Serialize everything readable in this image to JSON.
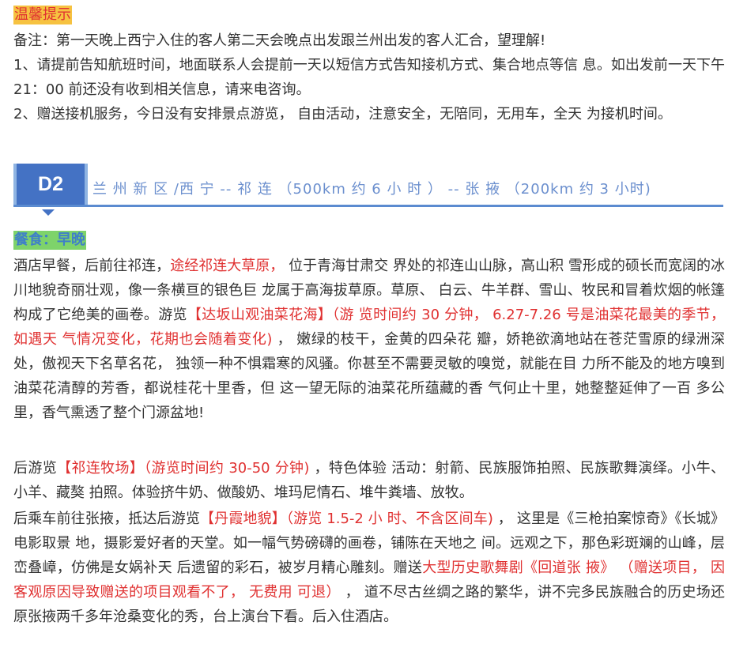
{
  "tips": {
    "title": "温馨提示",
    "note": "备注：第一天晚上西宁入住的客人第二天会晚点出发跟兰州出发的客人汇合，望理解!",
    "item1": "1、请提前告知航班时间，地面联系人会提前一天以短信方式告知接机方式、集合地点等信 息。如出发前一天下午 21：00 前还没有收到相关信息，请来电咨询。",
    "item2": "2、赠送接机服务，今日没有安排景点游览， 自由活动，注意安全，无陪同，无用车，全天 为接机时间。"
  },
  "day": {
    "label": "D2",
    "route": "兰 州 新 区 /西 宁 -- 祁 连 （500km 约 6 小 时 ） -- 张 掖 （200km 约 3 小时)"
  },
  "meals": "餐食：早晚",
  "p1": {
    "t1": "酒店早餐，后前往祁连，",
    "r1": "途经祁连大草原，",
    "t2": " 位于青海甘肃交 界处的祁连山山脉，高山积 雪形成的硕长而宽阔的冰川地貌奇丽壮观，像一条横亘的银色巨 龙属于高海拔草原。草原、 白云、牛羊群、雪山、牧民和冒着炊烟的帐篷构成了它绝美的画卷。游览",
    "r2": "【达坂山观油菜花海】（游 览时间约 30 分钟， 6.27-7.26 号是油菜花最美的季节， 如遇天 气情况变化，花期也会随着变化)",
    "t3": " ， 嫩绿的枝干，金黄的四朵花 瓣，娇艳欲滴地站在苍茫雪原的绿洲深处，傲视天下名草名花， 独领一种不惧霜寒的风骚。你甚至不需要灵敏的嗅觉，就能在目 力所不能及的地方嗅到油菜花清醇的芳香，都说桂花十里香，但 这一望无际的油菜花所蕴藏的香 气何止十里，她整整延伸了一百 多公里，香气熏透了整个门源盆地!"
  },
  "p2": {
    "t1": "后游览",
    "r1": "【祁连牧场】（游览时间约 30-50 分钟)",
    "t2": " ，特色体验 活动：射箭、民族服饰拍照、民族歌舞演绎。小牛、小羊、藏獒 拍照。体验挤牛奶、做酸奶、堆玛尼情石、堆牛粪墙、放牧。"
  },
  "p3": {
    "t1": "后乘车前往张掖，抵达后游览",
    "r1": "【丹霞地貌】（游览 1.5-2 小 时、不含区间车)",
    "t2": " ， 这里是《三枪拍案惊奇》《长城》 电影取景 地，摄影爱好者的天堂。如一幅气势磅礴的画卷，铺陈在天地之 间。远观之下，那色彩斑斓的山峰，层峦叠嶂，仿佛是女娲补天 后遗留的彩石，被岁月精心雕刻。赠送",
    "r2": "大型历史歌舞剧《回道张 掖》 （赠送项目， 因客观原因导致赠送的项目观看不了， 无费用 可退）",
    "t3": " ， 道不尽古丝绸之路的繁华，讲不完多民族融合的历史场还原张掖两千多年沧桑变化的秀，台上演台下看。后入住酒店。"
  },
  "colors": {
    "red": "#e03131",
    "blue": "#4472c4",
    "tip_bg": "#f6c241",
    "meal_bg": "#7ed36a"
  }
}
